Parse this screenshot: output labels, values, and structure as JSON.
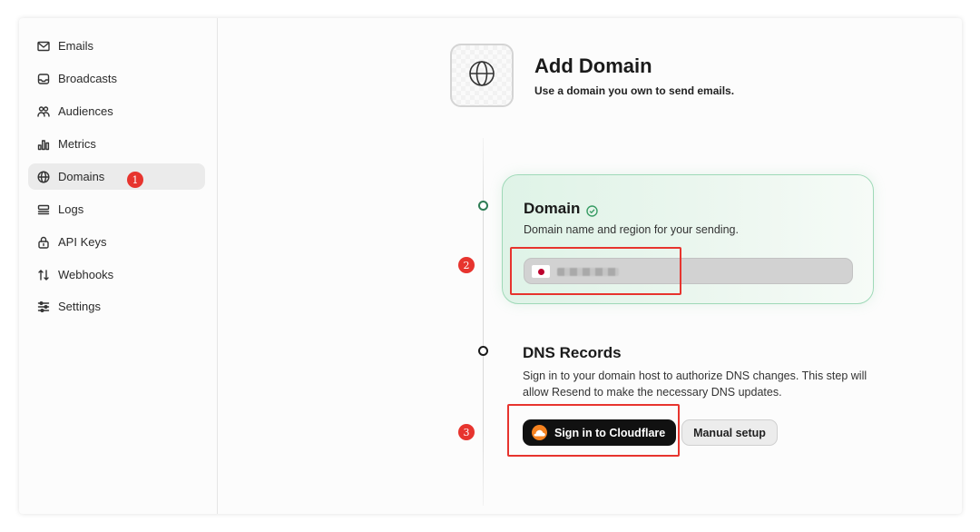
{
  "sidebar": {
    "items": [
      {
        "label": "Emails",
        "icon": "mail-icon"
      },
      {
        "label": "Broadcasts",
        "icon": "inbox-icon"
      },
      {
        "label": "Audiences",
        "icon": "users-icon"
      },
      {
        "label": "Metrics",
        "icon": "bar-chart-icon"
      },
      {
        "label": "Domains",
        "icon": "globe-icon",
        "active": true
      },
      {
        "label": "Logs",
        "icon": "logs-icon"
      },
      {
        "label": "API Keys",
        "icon": "lock-icon"
      },
      {
        "label": "Webhooks",
        "icon": "webhook-icon"
      },
      {
        "label": "Settings",
        "icon": "sliders-icon"
      }
    ]
  },
  "header": {
    "title": "Add Domain",
    "subtitle": "Use a domain you own to send emails.",
    "logo_icon": "globe-icon"
  },
  "steps": {
    "domain": {
      "title": "Domain",
      "description": "Domain name and region for your sending.",
      "input_value": "",
      "region_flag": "japan-flag-icon",
      "status_color": "#2e7d55"
    },
    "dns": {
      "title": "DNS Records",
      "description": "Sign in to your domain host to authorize DNS changes. This step will allow Resend to make the necessary DNS updates.",
      "primary_button": "Sign in to Cloudflare",
      "secondary_button": "Manual setup",
      "provider_icon": "cloudflare-icon",
      "provider_color": "#f6821f"
    }
  },
  "annotations": {
    "color": "#e7342e",
    "badges": [
      "1",
      "2",
      "3"
    ]
  }
}
